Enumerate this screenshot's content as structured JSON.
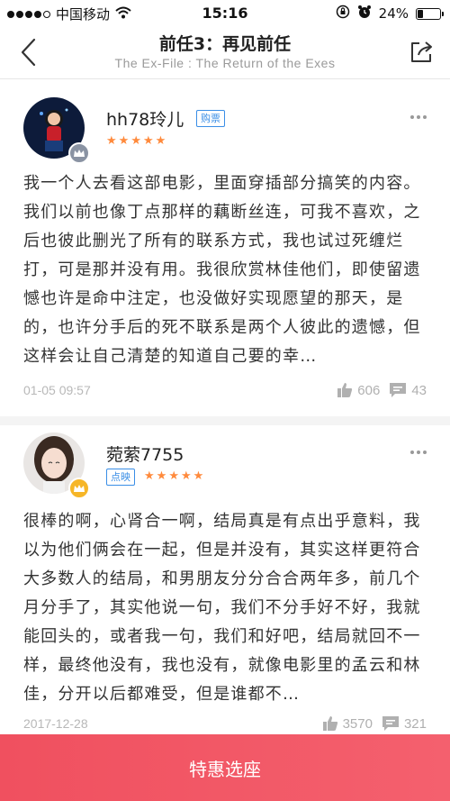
{
  "status_bar": {
    "carrier": "中国移动",
    "time": "15:16",
    "battery": "24%",
    "battery_level": 0.24,
    "icons": [
      "signal-dots-icon",
      "wifi-icon",
      "orientation-lock-icon",
      "alarm-icon",
      "battery-icon"
    ]
  },
  "nav": {
    "title": "前任3：再见前任",
    "subtitle": "The Ex-File : The Return of the Exes",
    "icons": [
      "back-chevron-icon",
      "share-icon"
    ]
  },
  "comments": [
    {
      "username": "hh78玲儿",
      "tag": "购票",
      "rating": 5,
      "text": "我一个人去看这部电影，里面穿插部分搞笑的内容。我们以前也像丁点那样的藕断丝连，可我不喜欢，之后也彼此删光了所有的联系方式，我也试过死缠烂打，可是那并没有用。我很欣赏林佳他们，即使留遗憾也许是命中注定，也没做好实现愿望的那天，是的，也许分手后的死不联系是两个人彼此的遗憾，但这样会让自己清楚的知道自己要的幸…",
      "time": "01-05 09:57",
      "likes": "606",
      "replies": "43"
    },
    {
      "username": "菀萦7755",
      "tag": "点映",
      "rating": 5,
      "text": "很棒的啊，心肾合一啊，结局真是有点出乎意料，我以为他们俩会在一起，但是并没有，其实这样更符合大多数人的结局，和男朋友分分合合两年多，前几个月分手了，其实他说一句，我们不分手好不好，我就能回头的，或者我一句，我们和好吧，结局就回不一样，最终他没有，我也没有，就像电影里的孟云和林佳，分开以后都难受，但是谁都不…",
      "time": "2017-12-28",
      "likes": "3570",
      "replies": "321"
    }
  ],
  "cta": {
    "label": "特惠选座"
  },
  "colors": {
    "accent": "#f0505f",
    "star": "#ff8a3c",
    "tag_blue": "#3a8ee6",
    "muted": "#b0b0b0"
  }
}
